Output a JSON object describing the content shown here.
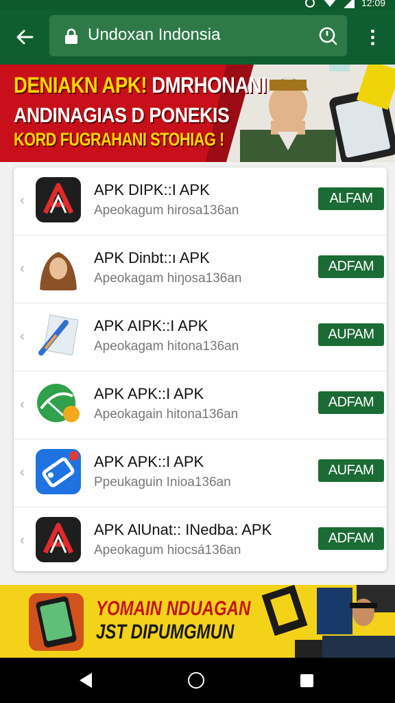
{
  "status_bar": {
    "time": "12:09"
  },
  "address_bar": {
    "url_text": "Undoxan Indonsia"
  },
  "top_banner": {
    "line1_a": "DENIAKN APK!",
    "line1_b": " DMRHONANI",
    "line2": "ANDINAGIAS D PONEKIS",
    "line3": "KORD FUGRAHANI STOHIAG !"
  },
  "apps": [
    {
      "title": "APK DIPK::I APK",
      "subtitle": "Apeokagum hirosa136an",
      "button": "ALFAM",
      "icon": "red-a-logo-icon"
    },
    {
      "title": "APK Dinbt::ı APK",
      "subtitle": "Apeokagam hiŋosa136an",
      "button": "ADFAM",
      "icon": "woman-portrait-icon"
    },
    {
      "title": "APK AIPK::I APK",
      "subtitle": "Apeokagam hitona136an",
      "button": "AUPAM",
      "icon": "pen-paper-icon"
    },
    {
      "title": "APK APK::I APK",
      "subtitle": "Apeokagain hitona136an",
      "button": "ADFAM",
      "icon": "green-circle-icon"
    },
    {
      "title": "APK APK::I APK",
      "subtitle": "Ppeukaguin Inioa136an",
      "button": "AUFAM",
      "icon": "blue-tag-icon"
    },
    {
      "title": "APK AlUnat:: INedba: APK",
      "subtitle": "Apeokagum hiocsá136an",
      "button": "ADFAM",
      "icon": "red-a-logo-icon"
    }
  ],
  "bottom_banner": {
    "line1": "YOMAIN NDUAGAN",
    "line2": "JST DIPUMGMUN"
  },
  "colors": {
    "appbar": "#0f5e2f",
    "button": "#1b6b34",
    "banner_red": "#c8101a",
    "banner_yellow": "#f3d21a"
  }
}
